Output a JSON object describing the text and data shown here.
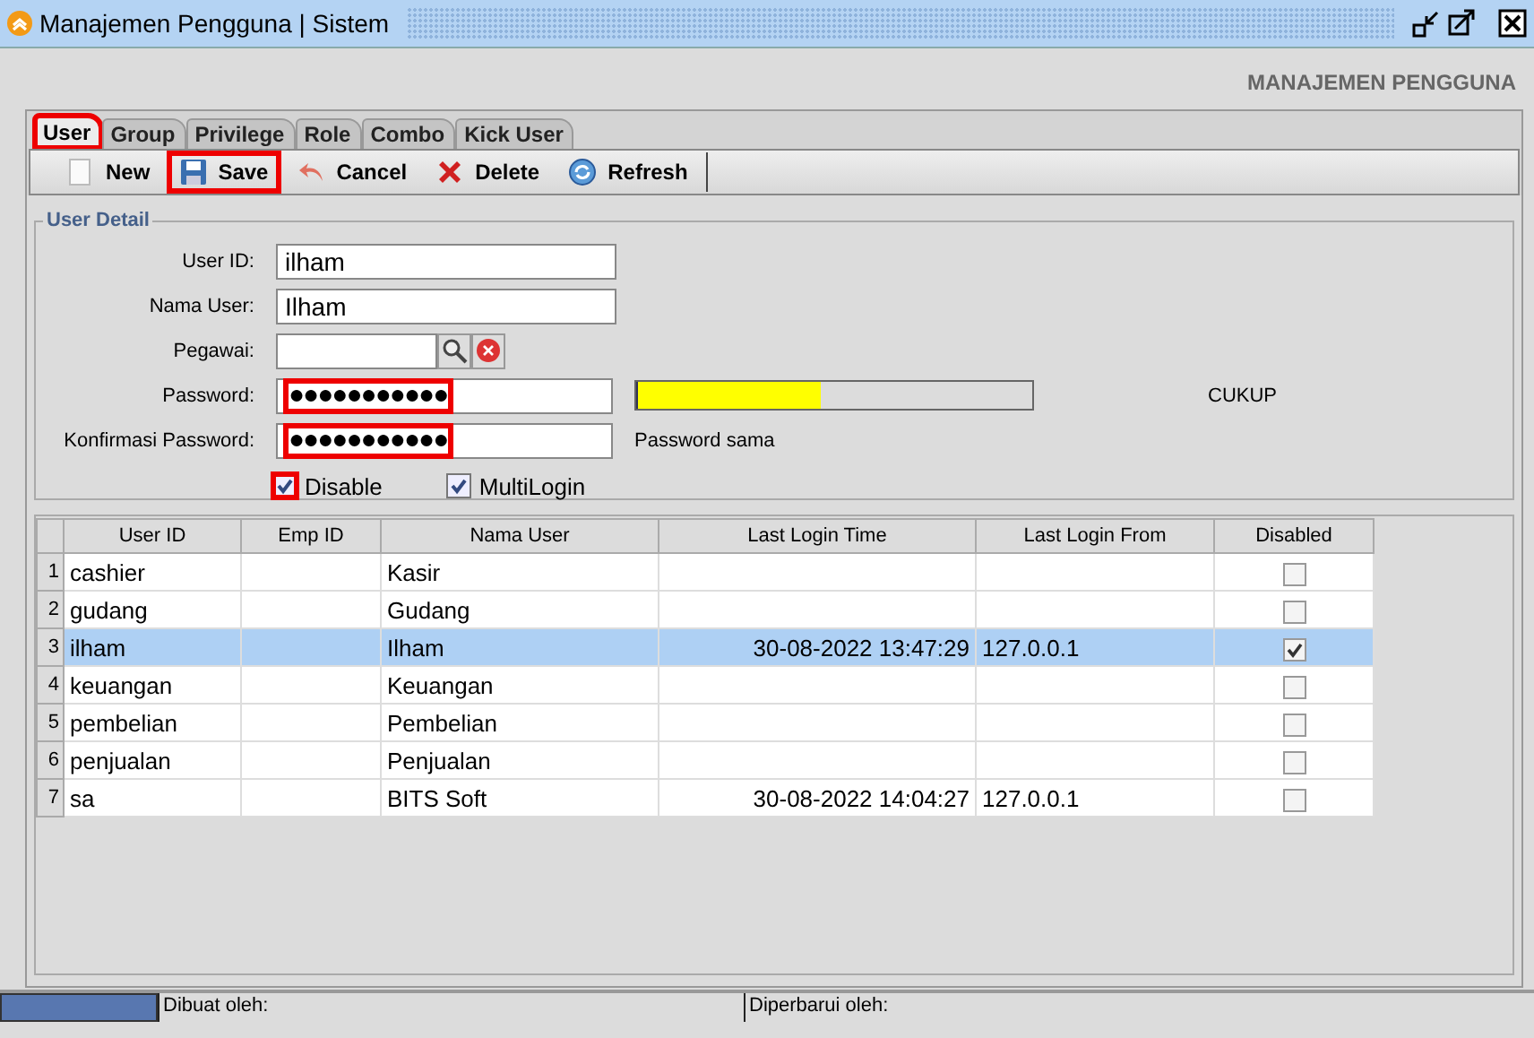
{
  "window": {
    "title": "Manajemen Pengguna | Sistem"
  },
  "header": "MANAJEMEN PENGGUNA",
  "tabs": [
    {
      "label": "User",
      "selected": true,
      "highlighted": true
    },
    {
      "label": "Group",
      "selected": false,
      "highlighted": false
    },
    {
      "label": "Privilege",
      "selected": false,
      "highlighted": false
    },
    {
      "label": "Role",
      "selected": false,
      "highlighted": false
    },
    {
      "label": "Combo",
      "selected": false,
      "highlighted": false
    },
    {
      "label": "Kick User",
      "selected": false,
      "highlighted": false
    }
  ],
  "toolbar": [
    {
      "label": "New",
      "kind": "new",
      "highlighted": false
    },
    {
      "label": "Save",
      "kind": "save",
      "highlighted": true
    },
    {
      "label": "Cancel",
      "kind": "cancel",
      "highlighted": false
    },
    {
      "label": "Delete",
      "kind": "delete",
      "highlighted": false
    },
    {
      "label": "Refresh",
      "kind": "refresh",
      "highlighted": false
    }
  ],
  "user_detail": {
    "title": "User Detail",
    "user_id": {
      "label": "User ID:",
      "value": "ilham"
    },
    "nama_user": {
      "label": "Nama User:",
      "value": "Ilham"
    },
    "pegawai": {
      "label": "Pegawai:"
    },
    "password": {
      "label": "Password:",
      "value": "●●●●●●●●●●●",
      "highlighted": true,
      "level": 0.46,
      "strength": "CUKUP"
    },
    "konfirmasi": {
      "label": "Konfirmasi Password:",
      "value": "●●●●●●●●●●●",
      "highlighted": true,
      "note": "Password sama"
    },
    "checkboxes": [
      {
        "label": "Disable",
        "checked": true,
        "highlighted": true
      },
      {
        "label": "MultiLogin",
        "checked": true,
        "highlighted": false
      }
    ]
  },
  "table": {
    "columns": [
      "User ID",
      "Emp ID",
      "Nama User",
      "Last Login Time",
      "Last Login From",
      "Disabled"
    ],
    "rows": [
      {
        "num": "1",
        "user_id": "cashier",
        "nama_user": "Kasir",
        "last_login_time": "",
        "last_login_from": "",
        "disabled": false,
        "selected": false
      },
      {
        "num": "2",
        "user_id": "gudang",
        "nama_user": "Gudang",
        "last_login_time": "",
        "last_login_from": "",
        "disabled": false,
        "selected": false
      },
      {
        "num": "3",
        "user_id": "ilham",
        "nama_user": "Ilham",
        "last_login_time": "30-08-2022 13:47:29",
        "last_login_from": "127.0.0.1",
        "disabled": true,
        "selected": true
      },
      {
        "num": "4",
        "user_id": "keuangan",
        "nama_user": "Keuangan",
        "last_login_time": "",
        "last_login_from": "",
        "disabled": false,
        "selected": false
      },
      {
        "num": "5",
        "user_id": "pembelian",
        "nama_user": "Pembelian",
        "last_login_time": "",
        "last_login_from": "",
        "disabled": false,
        "selected": false
      },
      {
        "num": "6",
        "user_id": "penjualan",
        "nama_user": "Penjualan",
        "last_login_time": "",
        "last_login_from": "",
        "disabled": false,
        "selected": false
      },
      {
        "num": "7",
        "user_id": "sa",
        "nama_user": "BITS Soft",
        "last_login_time": "30-08-2022 14:04:27",
        "last_login_from": "127.0.0.1",
        "disabled": false,
        "selected": false
      }
    ]
  },
  "status_bar": {
    "created_by": "Dibuat oleh:",
    "updated_by": "Diperbarui oleh:"
  }
}
